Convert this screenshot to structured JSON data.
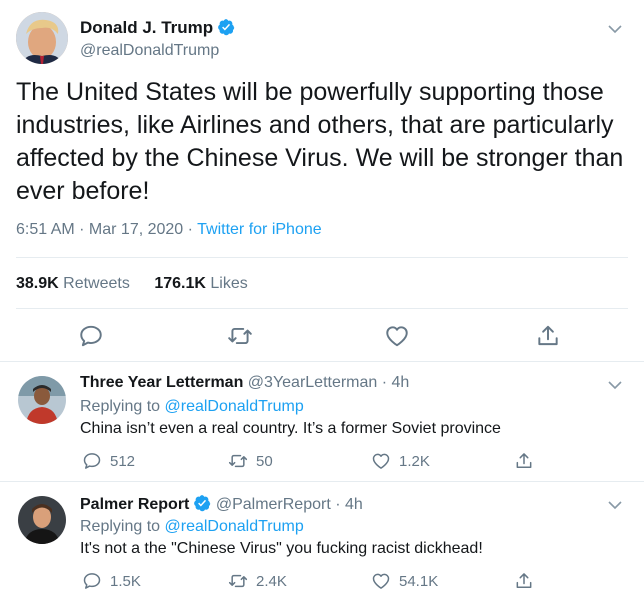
{
  "colors": {
    "link": "#1da1f2",
    "secondary_text": "#657786",
    "primary_text": "#14171a",
    "divider": "#e6ecf0",
    "verified_badge": "#1da1f2"
  },
  "main_tweet": {
    "name": "Donald J. Trump",
    "handle": "@realDonaldTrump",
    "verified": true,
    "text": "The United States will be powerfully supporting those industries, like Airlines and others, that are particularly affected by the Chinese Virus. We will be stronger than ever before!",
    "time": "6:51 AM · Mar 17, 2020 · ",
    "source": "Twitter for iPhone",
    "retweets_count": "38.9K",
    "retweets_label": "Retweets",
    "likes_count": "176.1K",
    "likes_label": "Likes",
    "icons": [
      "reply-icon",
      "retweet-icon",
      "like-icon",
      "share-icon"
    ]
  },
  "replies": [
    {
      "name": "Three Year Letterman",
      "handle": "@3YearLetterman · 4h",
      "verified": false,
      "replying_prefix": "Replying to ",
      "replying_to": "@realDonaldTrump",
      "text": "China isn’t even a real country. It’s a former Soviet province",
      "reply_count": "512",
      "retweet_count": "50",
      "like_count": "1.2K"
    },
    {
      "name": "Palmer Report",
      "handle": "@PalmerReport · 4h",
      "verified": true,
      "replying_prefix": "Replying to ",
      "replying_to": "@realDonaldTrump",
      "text": "It's not a the \"Chinese Virus\" you fucking racist dickhead!",
      "reply_count": "1.5K",
      "retweet_count": "2.4K",
      "like_count": "54.1K"
    }
  ]
}
